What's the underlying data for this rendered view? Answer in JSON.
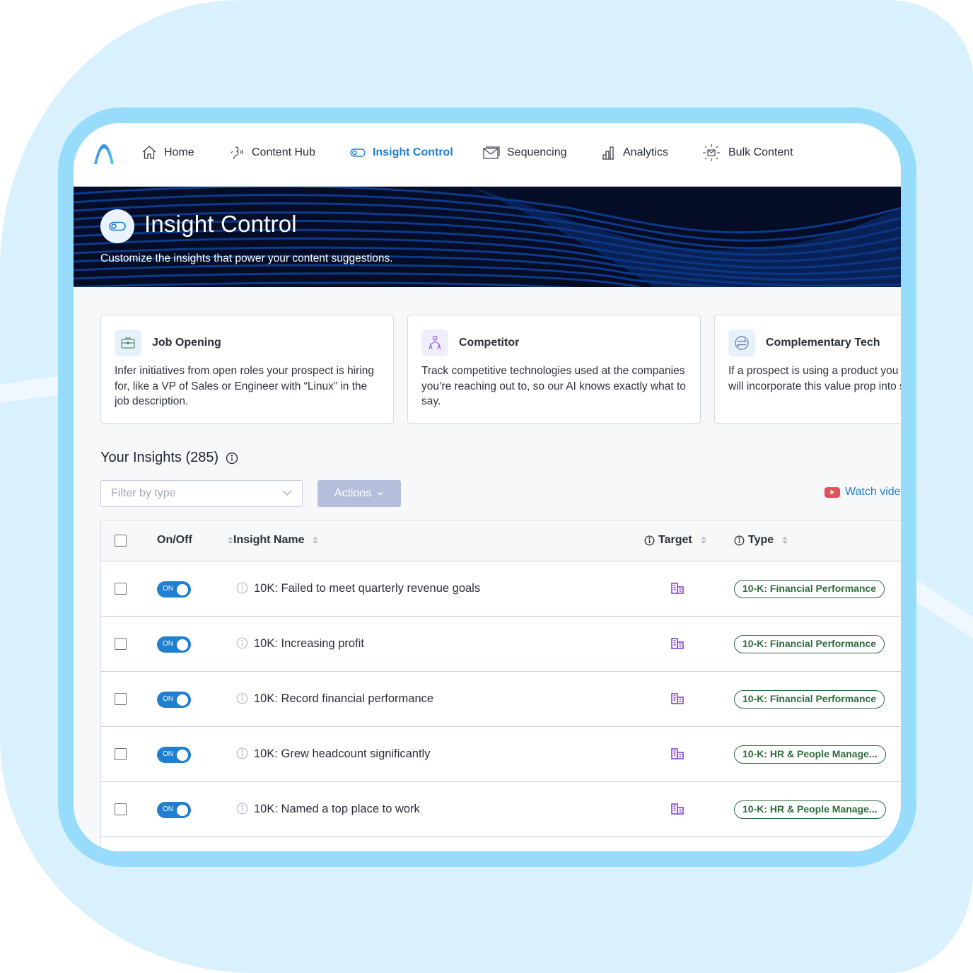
{
  "colors": {
    "accent": "#1f7fd0",
    "banner_bg": "#050d26",
    "badge_green": "#2f6b3d",
    "target_icon": "#8a45d6",
    "actions_disabled": "#b5bedb",
    "youtube_red": "#e05257"
  },
  "nav": {
    "logo": "brand-arch-logo",
    "items": [
      {
        "label": "Home",
        "icon": "home-icon",
        "active": false
      },
      {
        "label": "Content Hub",
        "icon": "content-hub-icon",
        "active": false
      },
      {
        "label": "Insight Control",
        "icon": "toggle-icon",
        "active": true
      },
      {
        "label": "Sequencing",
        "icon": "envelope-icon",
        "active": false
      },
      {
        "label": "Analytics",
        "icon": "bar-chart-icon",
        "active": false
      },
      {
        "label": "Bulk Content",
        "icon": "bulk-mail-icon",
        "active": false
      }
    ]
  },
  "banner": {
    "title": "Insight Control",
    "subtitle": "Customize the insights that power your content suggestions.",
    "icon": "toggle-icon"
  },
  "cards": [
    {
      "title": "Job Opening",
      "icon": "briefcase-icon",
      "description": "Infer initiatives from open roles your prospect is hiring for, like a VP of Sales or Engineer with “Linux” in the job description."
    },
    {
      "title": "Competitor",
      "icon": "org-chart-icon",
      "description": "Track competitive technologies used at the companies you’re reaching out to, so our AI knows exactly what to say."
    },
    {
      "title": "Complementary Tech",
      "icon": "exchange-icon",
      "description": "If a prospect is using a product you integrate with, our AI will incorporate this value prop into suggested content."
    }
  ],
  "insights": {
    "title": "Your Insights (285)",
    "count": 285,
    "filter_placeholder": "Filter by type",
    "actions_label": "Actions",
    "watch_video_label": "Watch video"
  },
  "table": {
    "columns": [
      "On/Off",
      "Insight Name",
      "Target",
      "Type"
    ],
    "rows": [
      {
        "enabled": true,
        "toggle_label": "ON",
        "name": "10K: Failed to meet quarterly revenue goals",
        "target": "company-building-icon",
        "type": "10-K: Financial Performance"
      },
      {
        "enabled": true,
        "toggle_label": "ON",
        "name": "10K: Increasing profit",
        "target": "company-building-icon",
        "type": "10-K: Financial Performance"
      },
      {
        "enabled": true,
        "toggle_label": "ON",
        "name": "10K: Record financial performance",
        "target": "company-building-icon",
        "type": "10-K: Financial Performance"
      },
      {
        "enabled": true,
        "toggle_label": "ON",
        "name": "10K: Grew headcount significantly",
        "target": "company-building-icon",
        "type": "10-K: HR & People Manage..."
      },
      {
        "enabled": true,
        "toggle_label": "ON",
        "name": "10K: Named a top place to work",
        "target": "company-building-icon",
        "type": "10-K: HR & People Manage..."
      }
    ]
  }
}
